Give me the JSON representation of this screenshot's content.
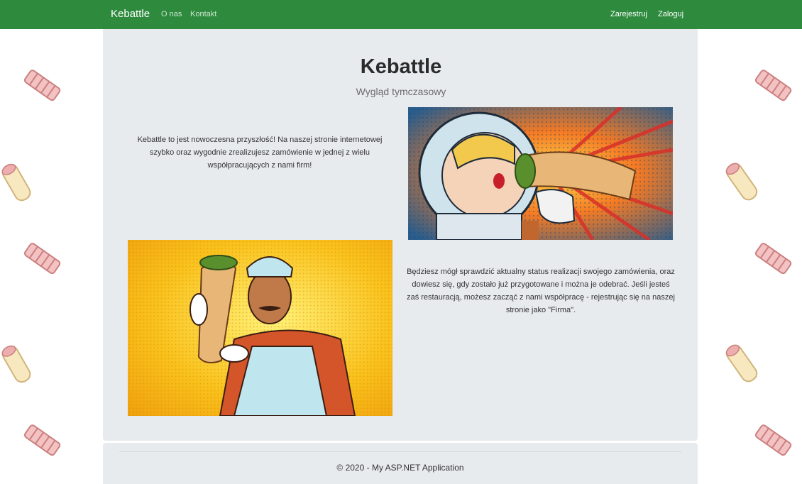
{
  "nav": {
    "brand": "Kebattle",
    "links": [
      "O nas",
      "Kontakt"
    ],
    "register": "Zarejestruj",
    "login": "Zaloguj",
    "bar_color": "#2e8b3e"
  },
  "hero": {
    "title": "Kebattle",
    "subtitle": "Wygląd tymczasowy"
  },
  "sections": [
    "Kebattle to jest nowoczesna przyszłość! Na naszej stronie internetowej szybko oraz wygodnie zrealizujesz zamówienie w jednej z wielu współpracujących z nami firm!",
    "Będziesz mógł sprawdzić aktualny status realizacji swojego zamówienia, oraz dowiesz się, gdy zostało już przygotowane i można je odebrać. Jeśli jesteś zaś restauracją, możesz zacząć z nami współpracę - rejestrując się na naszej stronie jako \"Firma\"."
  ],
  "images": [
    "astronaut-eating-kebab-illustration",
    "chef-holding-kebab-illustration"
  ],
  "footer": {
    "text": "© 2020 - My ASP.NET Application"
  },
  "background_icons": [
    "kebab-skewer-icon",
    "wrap-icon"
  ]
}
